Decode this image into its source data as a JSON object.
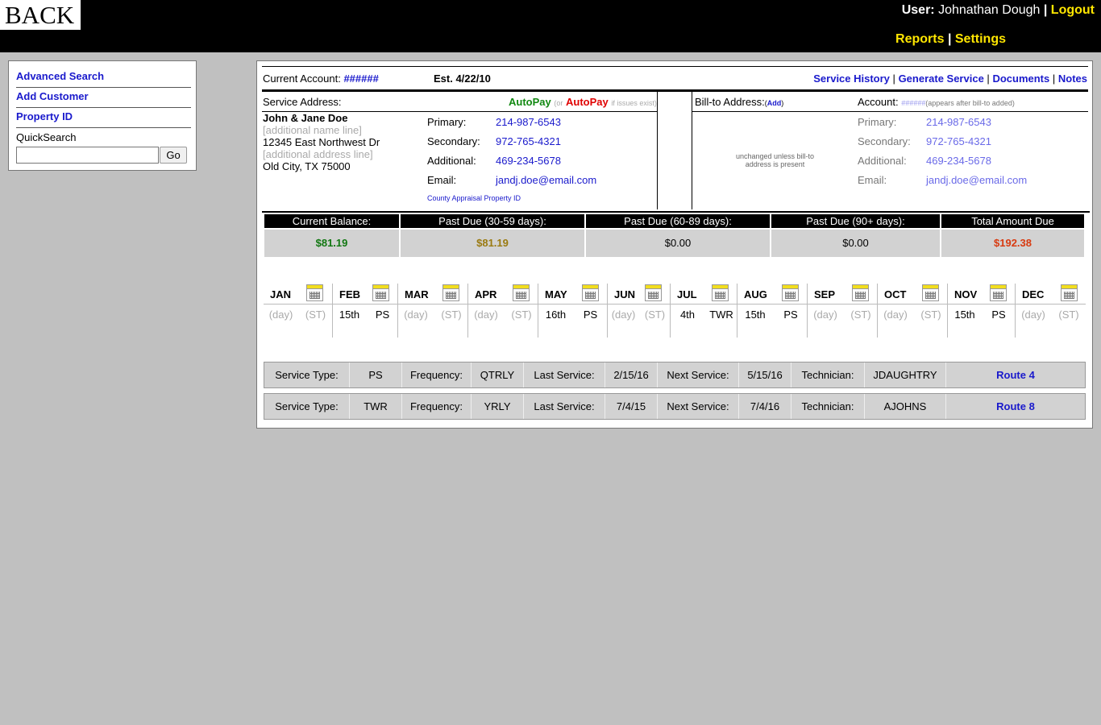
{
  "header": {
    "logo_text": "BACK",
    "user_label": "User:",
    "user_name": "Johnathan Dough",
    "separator": "|",
    "logout": "Logout",
    "nav": [
      "Reports",
      "Settings"
    ]
  },
  "sidebar": {
    "links": [
      "Advanced Search",
      "Add Customer",
      "Property ID"
    ],
    "quicksearch_label": "QuickSearch",
    "quicksearch_value": "",
    "go_label": "Go"
  },
  "account": {
    "label": "Current Account:",
    "number": "######",
    "established": "Est. 4/22/10",
    "links": [
      "Service History",
      "Generate Service",
      "Documents",
      "Notes"
    ]
  },
  "service_address": {
    "label": "Service Address:",
    "autopay_green": "AutoPay",
    "autopay_or": "(or",
    "autopay_red": "AutoPay",
    "autopay_suffix": "if issues exist)",
    "name": "John & Jane Doe",
    "additional_name": "[additional name line]",
    "street": "12345 East Northwest Dr",
    "additional_address": "[additional address line]",
    "city_line": "Old City, TX 75000",
    "contacts": [
      {
        "label": "Primary:",
        "value": "214-987-6543"
      },
      {
        "label": "Secondary:",
        "value": "972-765-4321"
      },
      {
        "label": "Additional:",
        "value": "469-234-5678"
      },
      {
        "label": "Email:",
        "value": "jandj.doe@email.com"
      }
    ],
    "county_link": "County Appraisal Property ID"
  },
  "bill_to": {
    "label": "Bill-to Address:",
    "add_open": "(",
    "add_label": "Add",
    "add_close": ")",
    "account_label": "Account:",
    "account_placeholder": "######",
    "account_note": "(appears after bill-to added)",
    "note": "unchanged unless bill-to address is present",
    "contacts": [
      {
        "label": "Primary:",
        "value": "214-987-6543"
      },
      {
        "label": "Secondary:",
        "value": "972-765-4321"
      },
      {
        "label": "Additional:",
        "value": "469-234-5678"
      },
      {
        "label": "Email:",
        "value": "jandj.doe@email.com"
      }
    ]
  },
  "balances": [
    {
      "label": "Current Balance:",
      "value": "$81.19",
      "color": "#117711",
      "bold": true
    },
    {
      "label": "Past Due (30-59 days):",
      "value": "$81.19",
      "color": "#9a7a10",
      "bold": true
    },
    {
      "label": "Past Due (60-89 days):",
      "value": "$0.00",
      "color": "#000000",
      "bold": false
    },
    {
      "label": "Past Due (90+ days):",
      "value": "$0.00",
      "color": "#000000",
      "bold": false
    },
    {
      "label": "Total Amount Due",
      "value": "$192.38",
      "color": "#d83a10",
      "bold": true
    }
  ],
  "calendar": [
    {
      "month": "JAN",
      "day": "(day)",
      "st": "(ST)",
      "placeholder": true
    },
    {
      "month": "FEB",
      "day": "15th",
      "st": "PS",
      "placeholder": false
    },
    {
      "month": "MAR",
      "day": "(day)",
      "st": "(ST)",
      "placeholder": true
    },
    {
      "month": "APR",
      "day": "(day)",
      "st": "(ST)",
      "placeholder": true
    },
    {
      "month": "MAY",
      "day": "16th",
      "st": "PS",
      "placeholder": false
    },
    {
      "month": "JUN",
      "day": "(day)",
      "st": "(ST)",
      "placeholder": true
    },
    {
      "month": "JUL",
      "day": "4th",
      "st": "TWR",
      "placeholder": false
    },
    {
      "month": "AUG",
      "day": "15th",
      "st": "PS",
      "placeholder": false
    },
    {
      "month": "SEP",
      "day": "(day)",
      "st": "(ST)",
      "placeholder": true
    },
    {
      "month": "OCT",
      "day": "(day)",
      "st": "(ST)",
      "placeholder": true
    },
    {
      "month": "NOV",
      "day": "15th",
      "st": "PS",
      "placeholder": false
    },
    {
      "month": "DEC",
      "day": "(day)",
      "st": "(ST)",
      "placeholder": true
    }
  ],
  "services": [
    {
      "service_type_label": "Service Type:",
      "service_type": "PS",
      "frequency_label": "Frequency:",
      "frequency": "QTRLY",
      "last_label": "Last Service:",
      "last": "2/15/16",
      "next_label": "Next Service:",
      "next": "5/15/16",
      "tech_label": "Technician:",
      "tech": "JDAUGHTRY",
      "route": "Route 4"
    },
    {
      "service_type_label": "Service Type:",
      "service_type": "TWR",
      "frequency_label": "Frequency:",
      "frequency": "YRLY",
      "last_label": "Last Service:",
      "last": "7/4/15",
      "next_label": "Next Service:",
      "next": "7/4/16",
      "tech_label": "Technician:",
      "tech": "AJOHNS",
      "route": "Route 8"
    }
  ]
}
